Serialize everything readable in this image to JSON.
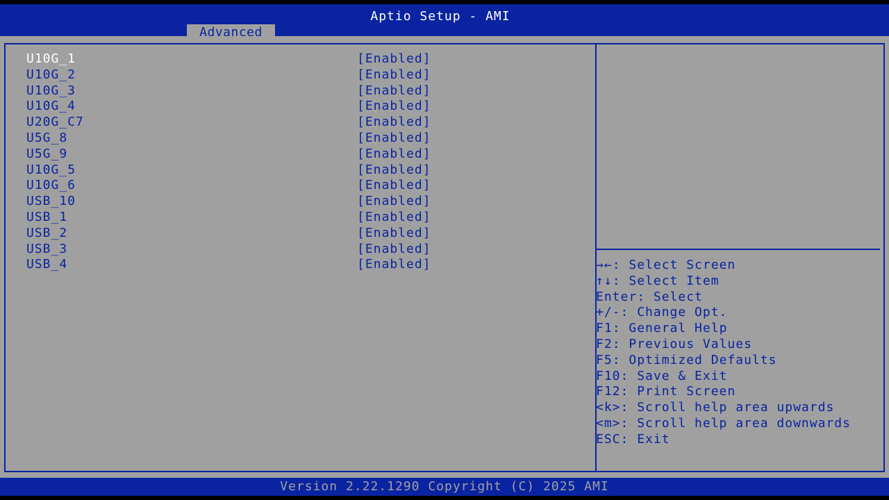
{
  "app": {
    "title": "Aptio Setup - AMI",
    "active_tab": "Advanced"
  },
  "settings": [
    {
      "label": "U10G_1",
      "value": "[Enabled]",
      "selected": true
    },
    {
      "label": "U10G_2",
      "value": "[Enabled]"
    },
    {
      "label": "U10G_3",
      "value": "[Enabled]"
    },
    {
      "label": "U10G_4",
      "value": "[Enabled]"
    },
    {
      "label": "U20G_C7",
      "value": "[Enabled]"
    },
    {
      "label": "U5G_8",
      "value": "[Enabled]"
    },
    {
      "label": "U5G_9",
      "value": "[Enabled]"
    },
    {
      "label": "U10G_5",
      "value": "[Enabled]"
    },
    {
      "label": "U10G_6",
      "value": "[Enabled]"
    },
    {
      "label": "USB_10",
      "value": "[Enabled]"
    },
    {
      "label": "USB_1",
      "value": "[Enabled]"
    },
    {
      "label": "USB_2",
      "value": "[Enabled]"
    },
    {
      "label": "USB_3",
      "value": "[Enabled]"
    },
    {
      "label": "USB_4",
      "value": "[Enabled]"
    }
  ],
  "help": [
    {
      "key": "→←",
      "text": ": Select Screen"
    },
    {
      "key": "↑↓",
      "text": ": Select Item"
    },
    {
      "key": "Enter",
      "text": ": Select"
    },
    {
      "key": "+/-",
      "text": ": Change Opt."
    },
    {
      "key": "F1",
      "text": ": General Help"
    },
    {
      "key": "F2",
      "text": ": Previous Values"
    },
    {
      "key": "F5",
      "text": ": Optimized Defaults"
    },
    {
      "key": "F10",
      "text": ": Save & Exit"
    },
    {
      "key": "F12",
      "text": ": Print Screen"
    },
    {
      "key": "<k>",
      "text": ": Scroll help area upwards"
    },
    {
      "key": "<m>",
      "text": ": Scroll help area downwards"
    },
    {
      "key": "ESC",
      "text": ": Exit"
    }
  ],
  "footer": {
    "version": "Version 2.22.1290 Copyright (C) 2025 AMI"
  },
  "colors": {
    "bios_blue": "#0a23a0",
    "panel_gray": "#a0a0a0",
    "highlight": "#ffffff"
  }
}
